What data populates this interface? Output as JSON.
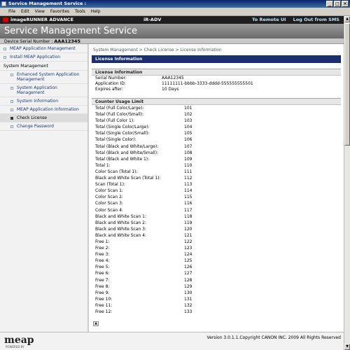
{
  "window": {
    "title": "Service Management Service :"
  },
  "menu": [
    "File",
    "Edit",
    "View",
    "Favorites",
    "Tools",
    "Help"
  ],
  "brand": {
    "name": "imageRUNNER ADVANCE",
    "model": "iR-ADV",
    "to_remote_ui": "To Remote UI",
    "logout": "Log Out from SMS"
  },
  "header": {
    "title": "Service Management Service"
  },
  "device": {
    "serial_label": "Device Serial Number :",
    "serial_value": "AAA12345"
  },
  "sidebar": {
    "meap_management": "MEAP Application Management",
    "install_meap": "Install MEAP Application",
    "system_management": "System Management",
    "enhanced": "Enhanced System Application Management",
    "system_app_mgmt": "System Application Management",
    "system_info": "System Information",
    "meap_app_info": "MEAP Application Information",
    "check_license": "Check License",
    "change_password": "Change Password"
  },
  "breadcrumb": "System Management > Check License > License Information",
  "page_title": "License Information",
  "license_info": {
    "title": "License Information",
    "rows": [
      {
        "label": "Serial Number:",
        "value": "AAA12345"
      },
      {
        "label": "Application ID:",
        "value": "11111111-bbbb-3333-dddd-555555555501"
      },
      {
        "label": "Expires after:",
        "value": "10 Days"
      }
    ]
  },
  "counter": {
    "title": "Counter Usage Limit",
    "rows": [
      {
        "label": "Total (Full Color/Large):",
        "value": "101"
      },
      {
        "label": "Total (Full Color/Small):",
        "value": "102"
      },
      {
        "label": "Total (Full Color 1):",
        "value": "103"
      },
      {
        "label": "Total (Single Color/Large):",
        "value": "104"
      },
      {
        "label": "Total (Single Color/Small):",
        "value": "105"
      },
      {
        "label": "Total (Single Color):",
        "value": "106"
      },
      {
        "label": "Total (Black and White/Large):",
        "value": "107"
      },
      {
        "label": "Total (Black and White/Small):",
        "value": "108"
      },
      {
        "label": "Total (Black and White 1):",
        "value": "109"
      },
      {
        "label": "Total 1:",
        "value": "110"
      },
      {
        "label": "Color Scan (Total 1):",
        "value": "111"
      },
      {
        "label": "Black and White Scan (Total 1):",
        "value": "112"
      },
      {
        "label": "Scan (Total 1):",
        "value": "113"
      },
      {
        "label": "Color Scan 1:",
        "value": "114"
      },
      {
        "label": "Color Scan 2:",
        "value": "115"
      },
      {
        "label": "Color Scan 3:",
        "value": "116"
      },
      {
        "label": "Color Scan 4:",
        "value": "117"
      },
      {
        "label": "Black and White Scan 1:",
        "value": "118"
      },
      {
        "label": "Black and White Scan 2:",
        "value": "119"
      },
      {
        "label": "Black and White Scan 3:",
        "value": "120"
      },
      {
        "label": "Black and White Scan 4:",
        "value": "121"
      },
      {
        "label": "Free 1:",
        "value": "122"
      },
      {
        "label": "Free 2:",
        "value": "123"
      },
      {
        "label": "Free 3:",
        "value": "124"
      },
      {
        "label": "Free 4:",
        "value": "125"
      },
      {
        "label": "Free 5:",
        "value": "126"
      },
      {
        "label": "Free 6:",
        "value": "127"
      },
      {
        "label": "Free 7:",
        "value": "128"
      },
      {
        "label": "Free 8:",
        "value": "129"
      },
      {
        "label": "Free 9:",
        "value": "130"
      },
      {
        "label": "Free 10:",
        "value": "131"
      },
      {
        "label": "Free 11:",
        "value": "132"
      },
      {
        "label": "Free 12:",
        "value": "133"
      }
    ]
  },
  "footer": {
    "logo": "meap",
    "powered_by": "POWERED BY",
    "copyright": "Version 3.0.1.1.Copyright CANON INC. 2009 All Rights Reserved"
  },
  "colors": {
    "header_band": "#7a7a7a",
    "page_header": "#1b2e6e",
    "brand_bar": "#1e1e1e",
    "link": "#1a3a7a"
  },
  "icons": {
    "scroll_top": "arrow-up-icon",
    "window_minimize": "minimize-icon",
    "window_maximize": "maximize-icon",
    "window_close": "close-icon"
  }
}
